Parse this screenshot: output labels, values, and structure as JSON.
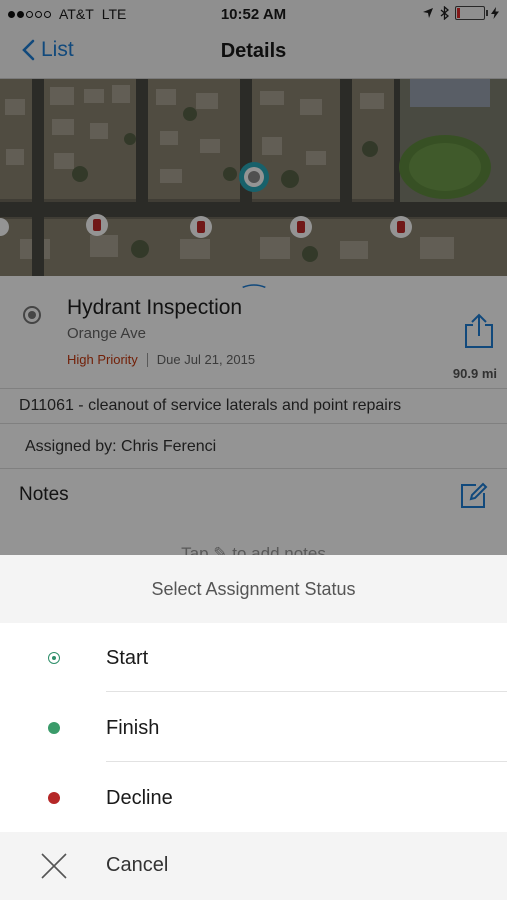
{
  "status_bar": {
    "carrier": "AT&T",
    "network": "LTE",
    "time": "10:52 AM",
    "signal_dots_filled": 2,
    "signal_dots_total": 5,
    "battery_level": 0.12
  },
  "nav": {
    "back_label": "List",
    "title": "Details"
  },
  "task": {
    "title": "Hydrant Inspection",
    "address": "Orange Ave",
    "priority": "High Priority",
    "due": "Due Jul 21, 2015",
    "distance": "90.9 mi",
    "description": "D11061 - cleanout of service laterals and point repairs",
    "assigned_by": "Assigned by: Chris Ferenci"
  },
  "notes": {
    "title": "Notes",
    "hint": "Tap ✎ to add notes"
  },
  "sheet": {
    "title": "Select Assignment Status",
    "options": [
      {
        "label": "Start",
        "icon": "start-radio-icon",
        "color": "#2f8f6a"
      },
      {
        "label": "Finish",
        "icon": "finish-dot-icon",
        "color": "#3a9b6a"
      },
      {
        "label": "Decline",
        "icon": "decline-dot-icon",
        "color": "#b52727"
      }
    ],
    "cancel_label": "Cancel"
  },
  "colors": {
    "accent": "#1e7fd6",
    "priority": "#c4380f",
    "map_marker": "#2aa7b8"
  }
}
